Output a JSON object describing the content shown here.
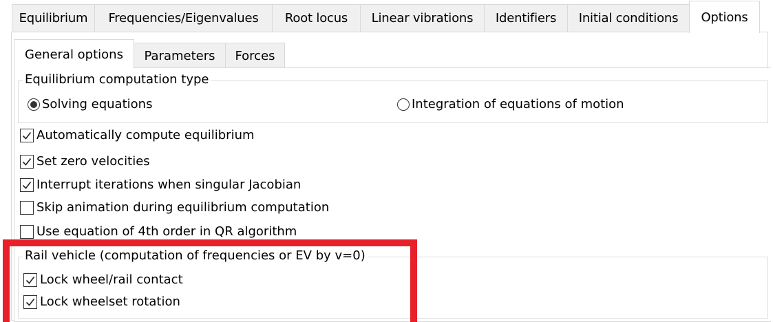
{
  "outer_tabs": [
    "Equilibrium",
    "Frequencies/Eigenvalues",
    "Root locus",
    "Linear vibrations",
    "Identifiers",
    "Initial conditions",
    "Options"
  ],
  "inner_tabs": [
    "General options",
    "Parameters",
    "Forces"
  ],
  "equilibrium_group": {
    "title": "Equilibrium computation type",
    "options": [
      {
        "label": "Solving equations",
        "selected": true
      },
      {
        "label": "Integration of equations of motion",
        "selected": false
      }
    ]
  },
  "checkboxes": [
    {
      "label": "Automatically compute equilibrium",
      "checked": true
    },
    {
      "label": "Set zero velocities",
      "checked": true
    },
    {
      "label": "Interrupt iterations when singular Jacobian",
      "checked": true
    },
    {
      "label": "Skip animation during equilibrium computation",
      "checked": false
    },
    {
      "label": "Use equation of 4th order in QR algorithm",
      "checked": false
    }
  ],
  "rail_group": {
    "title": "Rail vehicle (computation of frequencies or EV by v=0)",
    "checkboxes": [
      {
        "label": "Lock wheel/rail contact",
        "checked": true
      },
      {
        "label": "Lock wheelset rotation",
        "checked": true
      }
    ]
  },
  "highlight_color": "#e8202a"
}
